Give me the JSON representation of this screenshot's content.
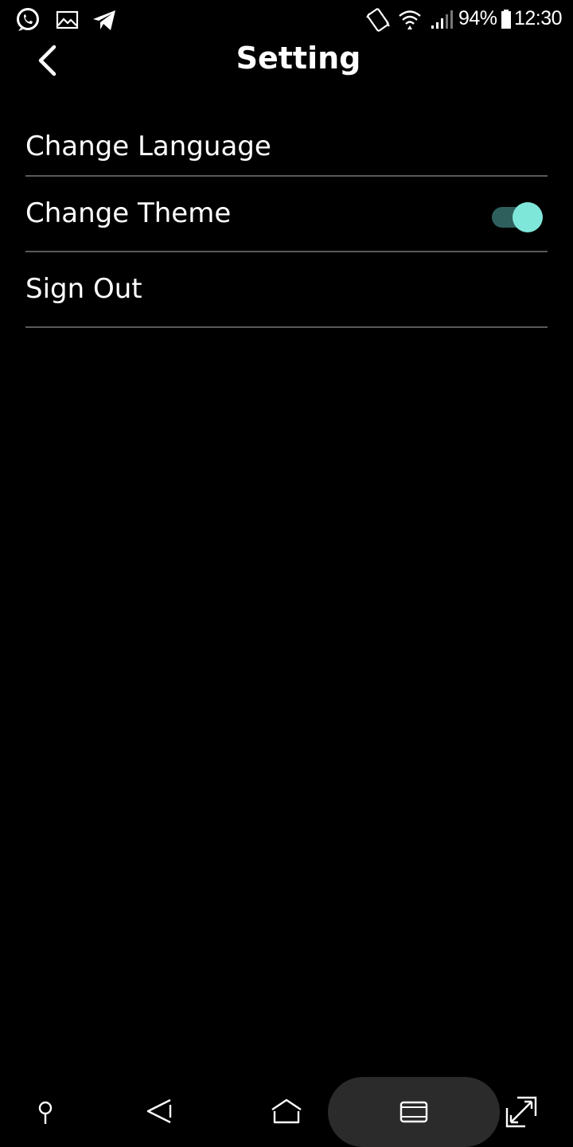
{
  "status_bar": {
    "left_icons": [
      "whatsapp-icon",
      "gallery-icon",
      "telegram-icon"
    ],
    "right_icons": [
      "vibrate-icon",
      "wifi-icon",
      "signal-icon",
      "battery-icon"
    ],
    "battery": "94%",
    "time": "12:30"
  },
  "header": {
    "title": "Setting",
    "back_icon": "chevron-left-icon"
  },
  "settings": {
    "items": [
      {
        "label": "Change Language"
      },
      {
        "label": "Change Theme",
        "toggle_on": true
      },
      {
        "label": "Sign Out"
      }
    ]
  },
  "colors": {
    "background": "#000000",
    "text": "#ffffff",
    "divider": "#5a5a5a",
    "toggle_thumb": "#7fe6da",
    "toggle_track": "#2f5f5c",
    "nav_pill": "#2b2b2b"
  },
  "nav_bar": {
    "icons": [
      "pin-icon",
      "back-triangle-icon",
      "home-icon",
      "recents-icon",
      "expand-icon"
    ]
  }
}
